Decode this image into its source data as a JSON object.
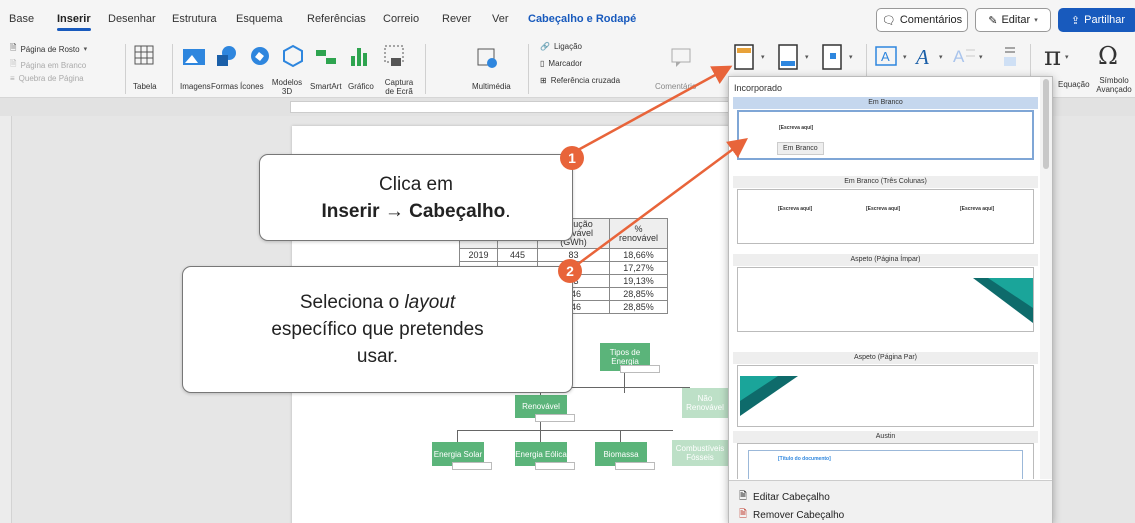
{
  "tabs": [
    "Base",
    "Inserir",
    "Desenhar",
    "Estrutura",
    "Esquema",
    "Referências",
    "Correio",
    "Rever",
    "Ver",
    "Cabeçalho e Rodapé"
  ],
  "top_buttons": {
    "comments": "Comentários",
    "edit": "Editar",
    "share": "Partilhar"
  },
  "ribbon": {
    "pages": [
      "Página de Rosto",
      "Página em Branco",
      "Quebra de Página"
    ],
    "table": "Tabela",
    "images": "Imagens",
    "shapes": "Formas",
    "icons": "Ícones",
    "models": "Modelos 3D",
    "smartart": "SmartArt",
    "chart": "Gráfico",
    "screenshot": "Captura de Ecrã",
    "media": "Multimédia",
    "links": [
      "Ligação",
      "Marcador",
      "Referência cruzada"
    ],
    "comment": "Comentário",
    "equation": "Equação",
    "symbol": "Símbolo Avançado"
  },
  "table": {
    "headers": [
      "",
      "Produção renovável (GWh)",
      "% renovável"
    ],
    "rows": [
      [
        "2019",
        "445",
        "83",
        "18,66%"
      ],
      [
        "",
        "",
        "73",
        "17,27%"
      ],
      [
        "",
        "",
        "83",
        "19,13%"
      ],
      [
        "",
        "",
        "146",
        "28,85%"
      ],
      [
        "",
        "",
        "146",
        "28,85%"
      ]
    ]
  },
  "org": {
    "root": "Tipos de Energia",
    "renew": "Renovável",
    "nonrenew": "Não Renovável",
    "solar": "Energia Solar",
    "wind": "Energia Eólica",
    "bio": "Biomassa",
    "fossil": "Combustíveis Fósseis"
  },
  "callout1": {
    "line1": "Clica em",
    "bold1": "Inserir",
    "arrow": "→",
    "bold2": "Cabeçalho",
    "end": "."
  },
  "callout2": {
    "pre": "Seleciona o",
    "italic": "layout",
    "line2": "específico que pretendes",
    "line3": "usar."
  },
  "badges": [
    "1",
    "2"
  ],
  "dropdown": {
    "heading": "Incorporado",
    "items": [
      "Em Branco",
      "Em Branco (Três Colunas)",
      "Aspeto (Página Ímpar)",
      "Aspeto (Página Par)",
      "Austin"
    ],
    "placeholder": "[Escreva aqui]",
    "doc_title_placeholder": "[Título do documento]",
    "tooltip": "Em Branco",
    "footer": [
      "Editar Cabeçalho",
      "Remover Cabeçalho"
    ]
  },
  "colors": {
    "accent": "#185abd",
    "badge": "#e8643a",
    "org_green": "#5bb47a"
  }
}
